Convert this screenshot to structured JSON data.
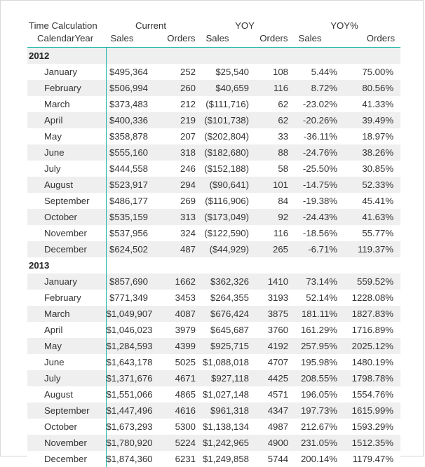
{
  "visual": {
    "name": "matrix-visual",
    "accent_color": "#16b5ab",
    "band_color": "#efefef",
    "text_color": "#333333"
  },
  "header": {
    "row_header_group_label": "Time Calculation",
    "row_header_field_label": "CalendarYear",
    "column_groups": [
      {
        "label": "Current",
        "span": 2
      },
      {
        "label": "YOY",
        "span": 2
      },
      {
        "label": "YOY%",
        "span": 2
      }
    ],
    "measures": [
      "Sales",
      "Orders",
      "Sales",
      "Orders",
      "Sales",
      "Orders"
    ]
  },
  "columns": [
    "CalendarYear",
    "Current Sales",
    "Current Orders",
    "YOY Sales",
    "YOY Orders",
    "YOY% Sales",
    "YOY% Orders"
  ],
  "rows": [
    {
      "type": "year",
      "label": "2012",
      "cells": [
        "",
        "",
        "",
        "",
        "",
        ""
      ]
    },
    {
      "type": "month",
      "label": "January",
      "cells": [
        "$495,364",
        "252",
        "$25,540",
        "108",
        "5.44%",
        "75.00%"
      ]
    },
    {
      "type": "month",
      "label": "February",
      "cells": [
        "$506,994",
        "260",
        "$40,659",
        "116",
        "8.72%",
        "80.56%"
      ]
    },
    {
      "type": "month",
      "label": "March",
      "cells": [
        "$373,483",
        "212",
        "($111,716)",
        "62",
        "-23.02%",
        "41.33%"
      ]
    },
    {
      "type": "month",
      "label": "April",
      "cells": [
        "$400,336",
        "219",
        "($101,738)",
        "62",
        "-20.26%",
        "39.49%"
      ]
    },
    {
      "type": "month",
      "label": "May",
      "cells": [
        "$358,878",
        "207",
        "($202,804)",
        "33",
        "-36.11%",
        "18.97%"
      ]
    },
    {
      "type": "month",
      "label": "June",
      "cells": [
        "$555,160",
        "318",
        "($182,680)",
        "88",
        "-24.76%",
        "38.26%"
      ]
    },
    {
      "type": "month",
      "label": "July",
      "cells": [
        "$444,558",
        "246",
        "($152,188)",
        "58",
        "-25.50%",
        "30.85%"
      ]
    },
    {
      "type": "month",
      "label": "August",
      "cells": [
        "$523,917",
        "294",
        "($90,641)",
        "101",
        "-14.75%",
        "52.33%"
      ]
    },
    {
      "type": "month",
      "label": "September",
      "cells": [
        "$486,177",
        "269",
        "($116,906)",
        "84",
        "-19.38%",
        "45.41%"
      ]
    },
    {
      "type": "month",
      "label": "October",
      "cells": [
        "$535,159",
        "313",
        "($173,049)",
        "92",
        "-24.43%",
        "41.63%"
      ]
    },
    {
      "type": "month",
      "label": "November",
      "cells": [
        "$537,956",
        "324",
        "($122,590)",
        "116",
        "-18.56%",
        "55.77%"
      ]
    },
    {
      "type": "month",
      "label": "December",
      "cells": [
        "$624,502",
        "487",
        "($44,929)",
        "265",
        "-6.71%",
        "119.37%"
      ]
    },
    {
      "type": "year",
      "label": "2013",
      "cells": [
        "",
        "",
        "",
        "",
        "",
        ""
      ]
    },
    {
      "type": "month",
      "label": "January",
      "cells": [
        "$857,690",
        "1662",
        "$362,326",
        "1410",
        "73.14%",
        "559.52%"
      ]
    },
    {
      "type": "month",
      "label": "February",
      "cells": [
        "$771,349",
        "3453",
        "$264,355",
        "3193",
        "52.14%",
        "1228.08%"
      ]
    },
    {
      "type": "month",
      "label": "March",
      "cells": [
        "$1,049,907",
        "4087",
        "$676,424",
        "3875",
        "181.11%",
        "1827.83%"
      ]
    },
    {
      "type": "month",
      "label": "April",
      "cells": [
        "$1,046,023",
        "3979",
        "$645,687",
        "3760",
        "161.29%",
        "1716.89%"
      ]
    },
    {
      "type": "month",
      "label": "May",
      "cells": [
        "$1,284,593",
        "4399",
        "$925,715",
        "4192",
        "257.95%",
        "2025.12%"
      ]
    },
    {
      "type": "month",
      "label": "June",
      "cells": [
        "$1,643,178",
        "5025",
        "$1,088,018",
        "4707",
        "195.98%",
        "1480.19%"
      ]
    },
    {
      "type": "month",
      "label": "July",
      "cells": [
        "$1,371,676",
        "4671",
        "$927,118",
        "4425",
        "208.55%",
        "1798.78%"
      ]
    },
    {
      "type": "month",
      "label": "August",
      "cells": [
        "$1,551,066",
        "4865",
        "$1,027,148",
        "4571",
        "196.05%",
        "1554.76%"
      ]
    },
    {
      "type": "month",
      "label": "September",
      "cells": [
        "$1,447,496",
        "4616",
        "$961,318",
        "4347",
        "197.73%",
        "1615.99%"
      ]
    },
    {
      "type": "month",
      "label": "October",
      "cells": [
        "$1,673,293",
        "5300",
        "$1,138,134",
        "4987",
        "212.67%",
        "1593.29%"
      ]
    },
    {
      "type": "month",
      "label": "November",
      "cells": [
        "$1,780,920",
        "5224",
        "$1,242,965",
        "4900",
        "231.05%",
        "1512.35%"
      ]
    },
    {
      "type": "month",
      "label": "December",
      "cells": [
        "$1,874,360",
        "6231",
        "$1,249,858",
        "5744",
        "200.14%",
        "1179.47%"
      ]
    }
  ]
}
